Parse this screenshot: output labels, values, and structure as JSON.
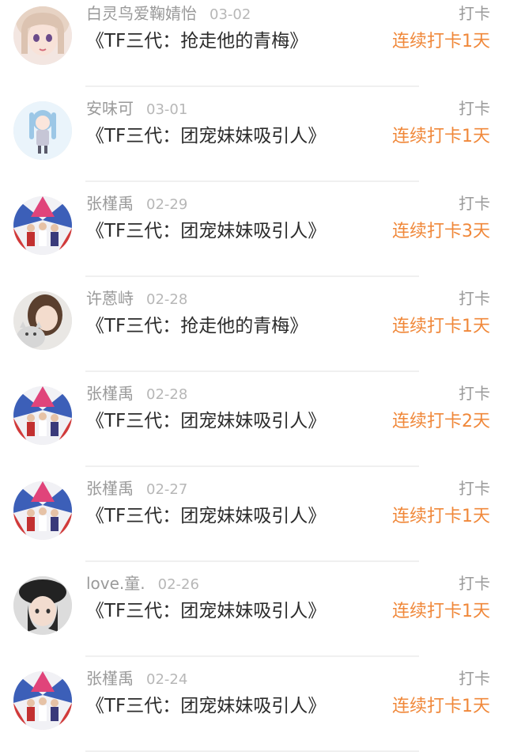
{
  "checkins": [
    {
      "user": "白灵鸟爱鞠婧怡",
      "date": "03-02",
      "title": "《TF三代：抢走他的青梅》",
      "action": "打卡",
      "streak": "连续打卡1天",
      "avatar": "avatar-anime-girl"
    },
    {
      "user": "安味可",
      "date": "03-01",
      "title": "《TF三代：团宠妹妹吸引人》",
      "action": "打卡",
      "streak": "连续打卡1天",
      "avatar": "avatar-chibi-girl"
    },
    {
      "user": "张槿禹",
      "date": "02-29",
      "title": "《TF三代：团宠妹妹吸引人》",
      "action": "打卡",
      "streak": "连续打卡3天",
      "avatar": "avatar-group-photo"
    },
    {
      "user": "许蒽峙",
      "date": "02-28",
      "title": "《TF三代：抢走他的青梅》",
      "action": "打卡",
      "streak": "连续打卡1天",
      "avatar": "avatar-girl-with-cat"
    },
    {
      "user": "张槿禹",
      "date": "02-28",
      "title": "《TF三代：团宠妹妹吸引人》",
      "action": "打卡",
      "streak": "连续打卡2天",
      "avatar": "avatar-group-photo"
    },
    {
      "user": "张槿禹",
      "date": "02-27",
      "title": "《TF三代：团宠妹妹吸引人》",
      "action": "打卡",
      "streak": "连续打卡1天",
      "avatar": "avatar-group-photo"
    },
    {
      "user": "love.童.",
      "date": "02-26",
      "title": "《TF三代：团宠妹妹吸引人》",
      "action": "打卡",
      "streak": "连续打卡1天",
      "avatar": "avatar-girl-with-hat"
    },
    {
      "user": "张槿禹",
      "date": "02-24",
      "title": "《TF三代：团宠妹妹吸引人》",
      "action": "打卡",
      "streak": "连续打卡1天",
      "avatar": "avatar-group-photo"
    }
  ],
  "colors": {
    "streak": "#f0883a",
    "meta": "#9a9a9a",
    "title": "#2b2b2b"
  }
}
